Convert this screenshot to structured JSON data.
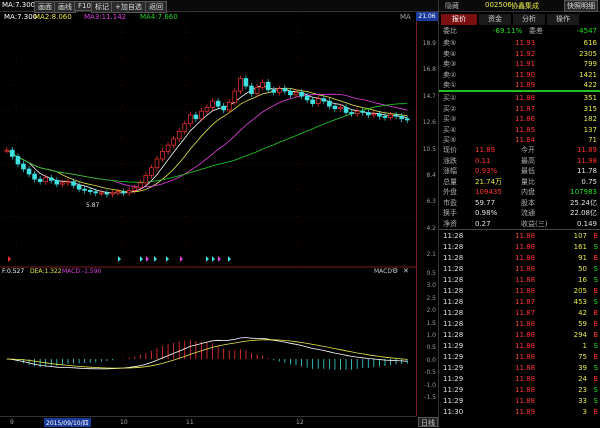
{
  "toolbar": {
    "ma_label": "MA:7.300",
    "nav_items": [
      "画面",
      "画线",
      "F10",
      "标记"
    ],
    "add_fav": "+加自选",
    "back": "返回",
    "ma2": "MA2:8.060",
    "ma3": "MA3:11.142",
    "ma4": "MA4:7.660",
    "ma_tag": "MA"
  },
  "stock": {
    "code": "002506",
    "name": "协鑫集成",
    "price_tag": "21.06",
    "status": "快照明细"
  },
  "panel_tabs": [
    "报价",
    "资金",
    "分析",
    "操作"
  ],
  "tab_extra": "隐藏",
  "weibi": {
    "label": "委比",
    "pct": "-69.11%",
    "label2": "委差",
    "diff": "-4547"
  },
  "asks": [
    {
      "label": "卖⑤",
      "price": "11.93",
      "vol": "616"
    },
    {
      "label": "卖④",
      "price": "11.92",
      "vol": "2305"
    },
    {
      "label": "卖③",
      "price": "11.91",
      "vol": "799"
    },
    {
      "label": "卖②",
      "price": "11.90",
      "vol": "1421"
    },
    {
      "label": "卖①",
      "price": "11.89",
      "vol": "422"
    }
  ],
  "bids": [
    {
      "label": "买①",
      "price": "11.88",
      "vol": "351"
    },
    {
      "label": "买②",
      "price": "11.87",
      "vol": "315"
    },
    {
      "label": "买③",
      "price": "11.86",
      "vol": "182"
    },
    {
      "label": "买④",
      "price": "11.85",
      "vol": "137"
    },
    {
      "label": "买⑤",
      "price": "11.84",
      "vol": "71"
    }
  ],
  "quote": [
    {
      "l1": "现价",
      "v1": "11.89",
      "l2": "今开",
      "v2": "11.89",
      "c1": "red",
      "c2": "red"
    },
    {
      "l1": "涨跌",
      "v1": "0.11",
      "l2": "最高",
      "v2": "11.98",
      "c1": "red",
      "c2": "red"
    },
    {
      "l1": "涨幅",
      "v1": "0.93%",
      "l2": "最低",
      "v2": "11.78",
      "c1": "red",
      "c2": "white"
    },
    {
      "l1": "总量",
      "v1": "21.74万",
      "l2": "量比",
      "v2": "0.75",
      "c1": "yellow",
      "c2": "white"
    },
    {
      "l1": "外盘",
      "v1": "109435",
      "l2": "内盘",
      "v2": "107983",
      "c1": "red",
      "c2": "green"
    },
    {
      "l1": "市盈",
      "v1": "59.77",
      "l2": "股本",
      "v2": "25.24亿",
      "c1": "white",
      "c2": "white"
    },
    {
      "l1": "换手",
      "v1": "0.98%",
      "l2": "流通",
      "v2": "22.08亿",
      "c1": "white",
      "c2": "white"
    },
    {
      "l1": "净资",
      "v1": "0.27",
      "l2": "收益(三)",
      "v2": "0.149",
      "c1": "white",
      "c2": "white"
    }
  ],
  "ticks": [
    {
      "t": "11:28",
      "p": "11.88",
      "v": "107",
      "d": "B"
    },
    {
      "t": "11:28",
      "p": "11.88",
      "v": "161",
      "d": "S"
    },
    {
      "t": "11:28",
      "p": "11.88",
      "v": "91",
      "d": "B"
    },
    {
      "t": "11:28",
      "p": "11.88",
      "v": "50",
      "d": "S"
    },
    {
      "t": "11:28",
      "p": "11.88",
      "v": "16",
      "d": "S"
    },
    {
      "t": "11:28",
      "p": "11.88",
      "v": "205",
      "d": "B"
    },
    {
      "t": "11:28",
      "p": "11.87",
      "v": "453",
      "d": "S"
    },
    {
      "t": "11:28",
      "p": "11.87",
      "v": "42",
      "d": "B"
    },
    {
      "t": "11:28",
      "p": "11.88",
      "v": "59",
      "d": "B"
    },
    {
      "t": "11:28",
      "p": "11.88",
      "v": "294",
      "d": "B"
    },
    {
      "t": "11:29",
      "p": "11.88",
      "v": "1",
      "d": "S"
    },
    {
      "t": "11:29",
      "p": "11.88",
      "v": "75",
      "d": "B"
    },
    {
      "t": "11:29",
      "p": "11.88",
      "v": "39",
      "d": "S"
    },
    {
      "t": "11:29",
      "p": "11.88",
      "v": "24",
      "d": "B"
    },
    {
      "t": "11:29",
      "p": "11.88",
      "v": "23",
      "d": "S"
    },
    {
      "t": "11:29",
      "p": "11.88",
      "v": "33",
      "d": "S"
    },
    {
      "t": "11:30",
      "p": "11.89",
      "v": "3",
      "d": "B"
    }
  ],
  "price_axis": [
    "18.9",
    "16.8",
    "14.7",
    "12.6",
    "10.5",
    "8.4",
    "6.3",
    "4.2",
    "2.1"
  ],
  "macd_axis": [
    "0.5",
    "3.0",
    "2.5",
    "2.0",
    "1.5",
    "1.0",
    "0.5",
    "0.0",
    "-0.5",
    "-1.0",
    "-1.5"
  ],
  "macd_header": {
    "dif": "F:0.527",
    "dea": "DEA:1.322",
    "macd": "MACD:-1.590",
    "name": "MACD"
  },
  "low_label": "5.87",
  "date_axis": {
    "d1": "9",
    "sel": "2015/09/10/四",
    "d2": "10",
    "d3": "11",
    "d4": "12"
  },
  "bottom_tab": "日线",
  "colors": {
    "up": "#ff3333",
    "down": "#40e0e0",
    "ma1": "#ffffff",
    "ma2": "#e8e84a",
    "ma3": "#e040e0",
    "ma4": "#22d022"
  }
}
